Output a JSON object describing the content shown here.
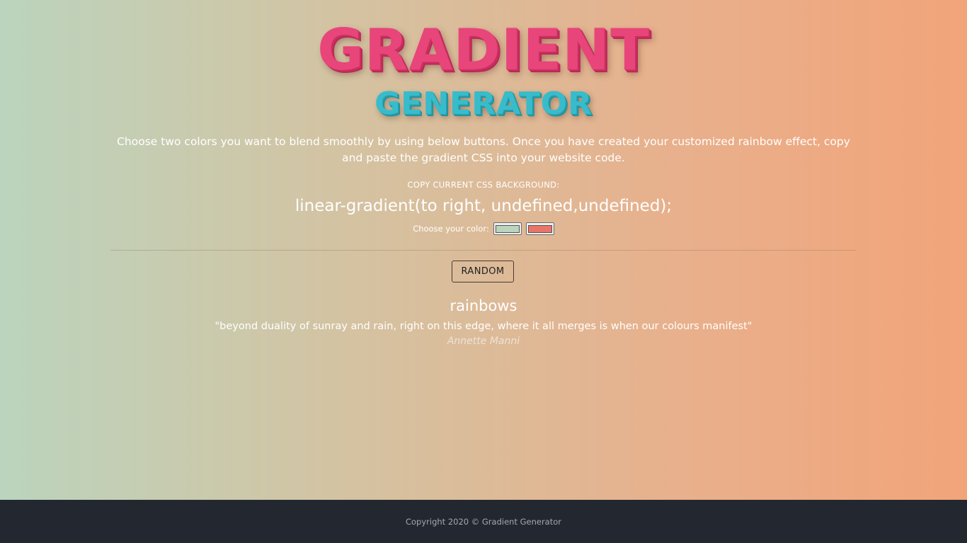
{
  "header": {
    "title": "GRADIENT",
    "subtitle": "GENERATOR"
  },
  "intro": {
    "text": "Choose two colors you want to blend smoothly by using below buttons. Once you have created your customized rainbow effect, copy and paste the gradient CSS into your website code."
  },
  "css_output": {
    "label": "COPY CURRENT CSS BACKGROUND:",
    "value": "linear-gradient(to right, undefined,undefined);"
  },
  "color_picker": {
    "label": "Choose your color:",
    "color1": "#bbd4bd",
    "color2": "#e87567"
  },
  "random_button": {
    "label": "RANDOM"
  },
  "quote": {
    "title": "rainbows",
    "text": "\"beyond duality of sunray and rain, right on this edge, where it all merges is when our colours manifest\"",
    "author": "Annette Manni"
  },
  "footer": {
    "text": "Copyright 2020 © Gradient Generator"
  },
  "colors": {
    "gradient_left": "#bbd4bd",
    "gradient_right": "#f2a479",
    "title": "#e8457a",
    "subtitle": "#38bccb",
    "footer_bg": "#232830"
  }
}
